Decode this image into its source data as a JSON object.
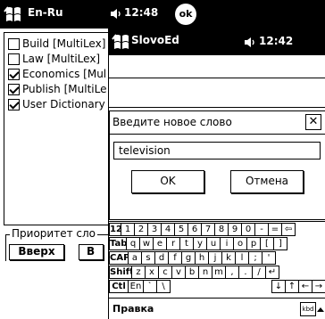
{
  "back_window": {
    "title": "En-Ru",
    "time": "12:48",
    "ok_label": "ok",
    "dictionaries": [
      {
        "label": "Build [MultiLex]",
        "checked": false
      },
      {
        "label": "Law [MultiLex]",
        "checked": false
      },
      {
        "label": "Economics [Mul",
        "checked": true
      },
      {
        "label": "Publish [MultiLe",
        "checked": true
      },
      {
        "label": "User Dictionary",
        "checked": true
      }
    ],
    "priority_label": "Приоритет сло",
    "up_button": "Вверх",
    "down_button_partial": "В"
  },
  "front_window": {
    "title": "SlovoEd",
    "time": "12:42",
    "dialog": {
      "title": "Введите новое слово",
      "close_label": "✕",
      "input_value": "television",
      "ok_label": "OK",
      "cancel_label": "Отмена"
    },
    "keyboard": {
      "rows": [
        [
          "123",
          "1",
          "2",
          "3",
          "4",
          "5",
          "6",
          "7",
          "8",
          "9",
          "0",
          "-",
          "=",
          "⇦"
        ],
        [
          "Tab",
          "q",
          "w",
          "e",
          "r",
          "t",
          "y",
          "u",
          "i",
          "o",
          "p",
          "[",
          "]"
        ],
        [
          "CAP",
          "a",
          "s",
          "d",
          "f",
          "g",
          "h",
          "j",
          "k",
          "l",
          ";",
          "'"
        ],
        [
          "Shift",
          "z",
          "x",
          "c",
          "v",
          "b",
          "n",
          "m",
          ",",
          ".",
          "/",
          "↵"
        ],
        [
          "Ctl",
          "En",
          "`",
          "\\",
          "↓",
          "↑",
          "←",
          "→"
        ]
      ]
    },
    "menu_label": "Правка",
    "sip_label": "kbd"
  }
}
